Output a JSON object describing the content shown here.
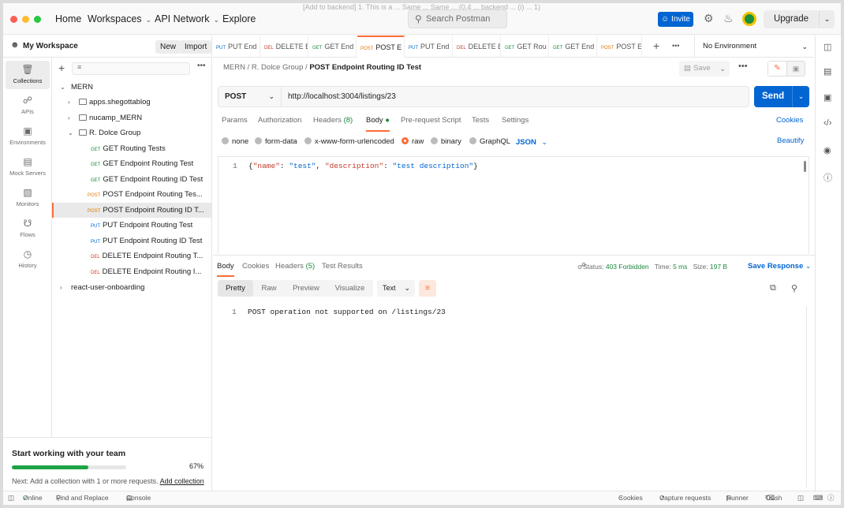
{
  "window": {
    "title_ghost": "[Add to backend] 1. This is a ... Same ... Same ... (0.4 ... backend ... (i) ... 1)"
  },
  "header": {
    "nav": [
      "Home",
      "Workspaces",
      "API Network",
      "Explore"
    ],
    "search_placeholder": "Search Postman",
    "invite_label": "Invite",
    "upgrade_label": "Upgrade"
  },
  "workspace": {
    "name": "My Workspace",
    "new_label": "New",
    "import_label": "Import"
  },
  "rail": [
    {
      "label": "Collections",
      "icon": "collections-icon",
      "active": true
    },
    {
      "label": "APIs",
      "icon": "apis-icon"
    },
    {
      "label": "Environments",
      "icon": "environments-icon"
    },
    {
      "label": "Mock Servers",
      "icon": "mock-servers-icon"
    },
    {
      "label": "Monitors",
      "icon": "monitors-icon"
    },
    {
      "label": "Flows",
      "icon": "flows-icon"
    },
    {
      "label": "History",
      "icon": "history-icon"
    }
  ],
  "tree": {
    "root": "MERN",
    "folders": [
      "apps.shegottablog",
      "nucamp_MERN",
      "R. Dolce Group"
    ],
    "requests": [
      {
        "method": "GET",
        "name": "GET Routing Tests"
      },
      {
        "method": "GET",
        "name": "GET Endpoint Routing Test"
      },
      {
        "method": "GET",
        "name": "GET Endpoint Routing ID Test"
      },
      {
        "method": "POST",
        "name": "POST Endpoint Routing Tes..."
      },
      {
        "method": "POST",
        "name": "POST Endpoint Routing ID T...",
        "selected": true
      },
      {
        "method": "PUT",
        "name": "PUT Endpoint Routing Test"
      },
      {
        "method": "PUT",
        "name": "PUT Endpoint Routing ID Test"
      },
      {
        "method": "DEL",
        "name": "DELETE Endpoint Routing T..."
      },
      {
        "method": "DEL",
        "name": "DELETE Endpoint Routing I..."
      }
    ],
    "other_collection": "react-user-onboarding"
  },
  "promo": {
    "title": "Start working with your team",
    "progress": 67,
    "progress_label": "67%",
    "next_text": "Next: Add a collection with 1 or more requests.",
    "link": "Add collection"
  },
  "tabs": [
    {
      "method": "PUT",
      "name": "PUT End"
    },
    {
      "method": "DEL",
      "name": "DELETE E"
    },
    {
      "method": "GET",
      "name": "GET End"
    },
    {
      "method": "POST",
      "name": "POST E",
      "active": true
    },
    {
      "method": "PUT",
      "name": "PUT End"
    },
    {
      "method": "DEL",
      "name": "DELETE E"
    },
    {
      "method": "GET",
      "name": "GET Rou"
    },
    {
      "method": "GET",
      "name": "GET End"
    },
    {
      "method": "POST",
      "name": "POST E"
    }
  ],
  "environment": "No Environment",
  "breadcrumb": {
    "a": "MERN",
    "b": "R. Dolce Group",
    "current": "POST Endpoint Routing ID Test"
  },
  "save_label": "Save",
  "request": {
    "method": "POST",
    "url": "http://localhost:3004/listings/23",
    "send_label": "Send"
  },
  "req_tabs": [
    "Params",
    "Authorization",
    "Headers",
    "Body",
    "Pre-request Script",
    "Tests",
    "Settings"
  ],
  "headers_count": "(8)",
  "cookies_label": "Cookies",
  "body_types": [
    "none",
    "form-data",
    "x-www-form-urlencoded",
    "raw",
    "binary",
    "GraphQL"
  ],
  "body_format": "JSON",
  "beautify_label": "Beautify",
  "editor": {
    "line": "1",
    "k1": "\"name\"",
    "v1": "\"test\"",
    "k2": "\"description\"",
    "v2": "\"test description\""
  },
  "response": {
    "tabs": [
      "Body",
      "Cookies",
      "Headers",
      "Test Results"
    ],
    "headers_count": "(5)",
    "status_label": "Status:",
    "status": "403 Forbidden",
    "time_label": "Time:",
    "time": "5 ms",
    "size_label": "Size:",
    "size": "197 B",
    "save_response": "Save Response",
    "views": [
      "Pretty",
      "Raw",
      "Preview",
      "Visualize"
    ],
    "format": "Text",
    "line": "1",
    "body": "POST operation not supported on /listings/23"
  },
  "statusbar": {
    "online": "Online",
    "find": "Find and Replace",
    "console": "Console",
    "cookies": "Cookies",
    "capture": "Capture requests",
    "runner": "Runner",
    "trash": "Trash"
  },
  "colors": {
    "accent": "#ff6c37",
    "primary": "#0265d2",
    "get": "#1b8a3e",
    "post": "#e07a00",
    "put": "#0265d2",
    "del": "#c63a2c"
  }
}
